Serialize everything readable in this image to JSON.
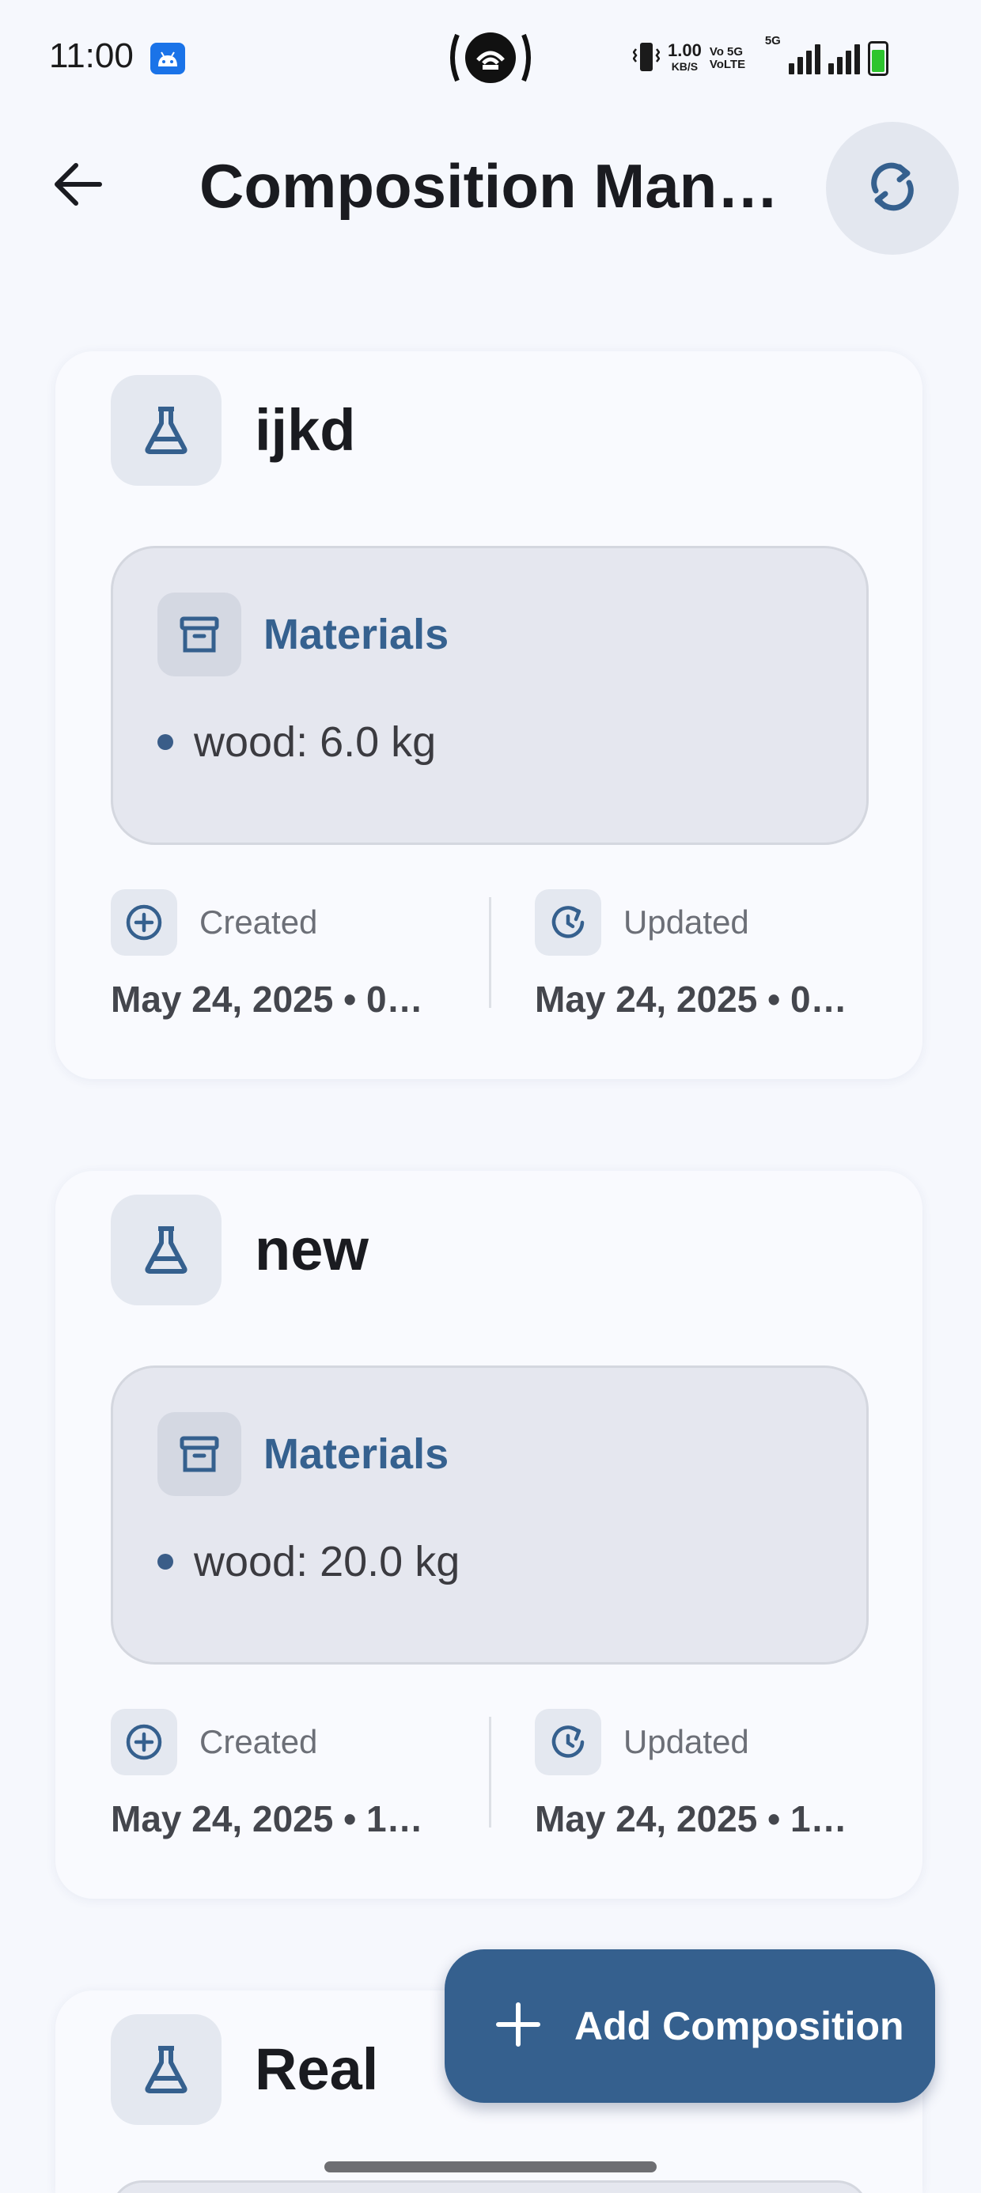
{
  "status_bar": {
    "time": "11:00",
    "speed_value": "1.00",
    "speed_unit": "KB/S",
    "network_label": "Vo 5G VoLTE",
    "network_type": "5G"
  },
  "app_bar": {
    "title": "Composition Man…",
    "back_icon": "arrow-left-icon",
    "refresh_icon": "refresh-icon"
  },
  "compositions": [
    {
      "name": "ijkd",
      "materials_heading": "Materials",
      "materials": [
        "wood: 6.0 kg"
      ],
      "created_label": "Created",
      "created_value": "May 24, 2025 • 0…",
      "updated_label": "Updated",
      "updated_value": "May 24, 2025 • 0…"
    },
    {
      "name": "new",
      "materials_heading": "Materials",
      "materials": [
        "wood: 20.0 kg"
      ],
      "created_label": "Created",
      "created_value": "May 24, 2025 • 1…",
      "updated_label": "Updated",
      "updated_value": "May 24, 2025 • 1…"
    },
    {
      "name": "Real"
    }
  ],
  "fab": {
    "label": "Add Composition",
    "icon": "plus-icon"
  },
  "colors": {
    "accent": "#35608e",
    "background": "#f6f8fd",
    "battery": "#2ec52e"
  }
}
